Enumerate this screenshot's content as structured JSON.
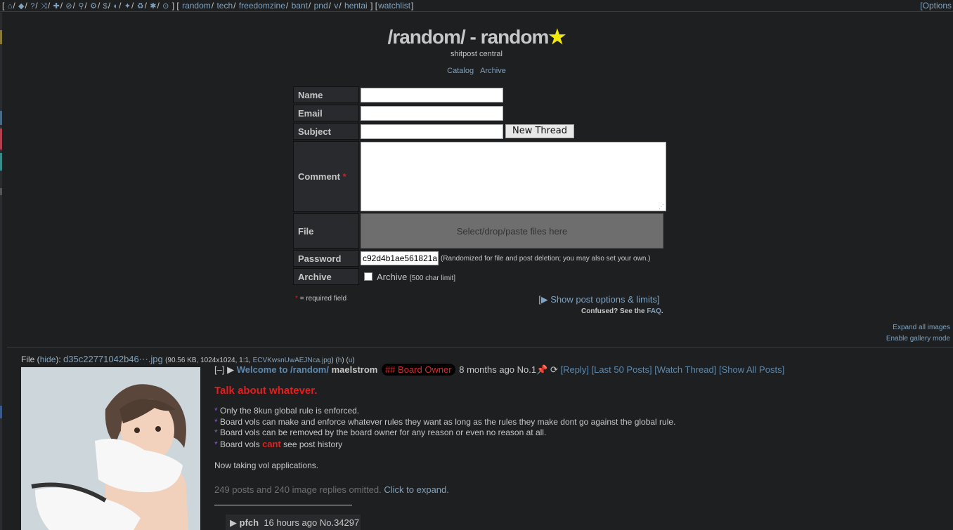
{
  "topbar": {
    "boards": [
      "random",
      "tech",
      "freedomzine",
      "bant",
      "pnd",
      "v",
      "hentai"
    ],
    "watchlist": "watchlist",
    "options": "[Options"
  },
  "board": {
    "title": "/random/ - random",
    "subtitle": "shitpost central",
    "catalog": "Catalog",
    "archive": "Archive"
  },
  "form": {
    "name_label": "Name",
    "email_label": "Email",
    "subject_label": "Subject",
    "comment_label": "Comment",
    "file_label": "File",
    "password_label": "Password",
    "archive_label": "Archive",
    "new_thread": "New Thread",
    "drop_text": "Select/drop/paste files here",
    "password_value": "c92d4b1ae561821a",
    "password_note": "(Randomized for file and post deletion; you may also set your own.)",
    "archive_text": "Archive",
    "archive_limit": "[500 char limit]",
    "required_star": "*",
    "required_note": "= required field",
    "post_options": "[▶ Show post options & limits]",
    "confused": "Confused? See the",
    "faq": "FAQ"
  },
  "page_links": {
    "expand_all": "Expand all images",
    "gallery": "Enable gallery mode"
  },
  "op": {
    "file_prefix": "File",
    "hide": "hide",
    "filename": "d35c22771042b46⋯.jpg",
    "fileinfo": "(90.56 KB, 1024x1024, 1:1,",
    "original_name": "ECVKwsnUwAEJNca.jpg",
    "h": "h",
    "u": "u",
    "hide_toggle": "[–]",
    "subject": "Welcome to /random/",
    "name": "maelstrom",
    "capcode": "## Board Owner",
    "time": "8 months ago",
    "no": "No.1",
    "reply": "[Reply]",
    "last50": "[Last 50 Posts]",
    "watch": "[Watch Thread]",
    "showall": "[Show All Posts]",
    "heading": "Talk about whatever.",
    "rules": [
      "Only the 8kun global rule is enforced.",
      "Board vols can make and enforce whatever rules they want as long as the rules they make dont go against the global rule.",
      "Board vols can be removed by the board owner for any reason or even no reason at all."
    ],
    "rule4_pre": "Board vols",
    "rule4_cant": "cant",
    "rule4_post": "see post history",
    "applications": "Now taking vol applications.",
    "omitted": "249 posts and 240 image replies omitted.",
    "expand": "Click to expand."
  },
  "reply": {
    "name": "pfch",
    "time": "16 hours ago",
    "no": "No.34297"
  },
  "colors": {
    "background": "#1d1f21",
    "link": "#81a2be",
    "star": "#f1e80d",
    "heading_red": "#e21f1f"
  }
}
